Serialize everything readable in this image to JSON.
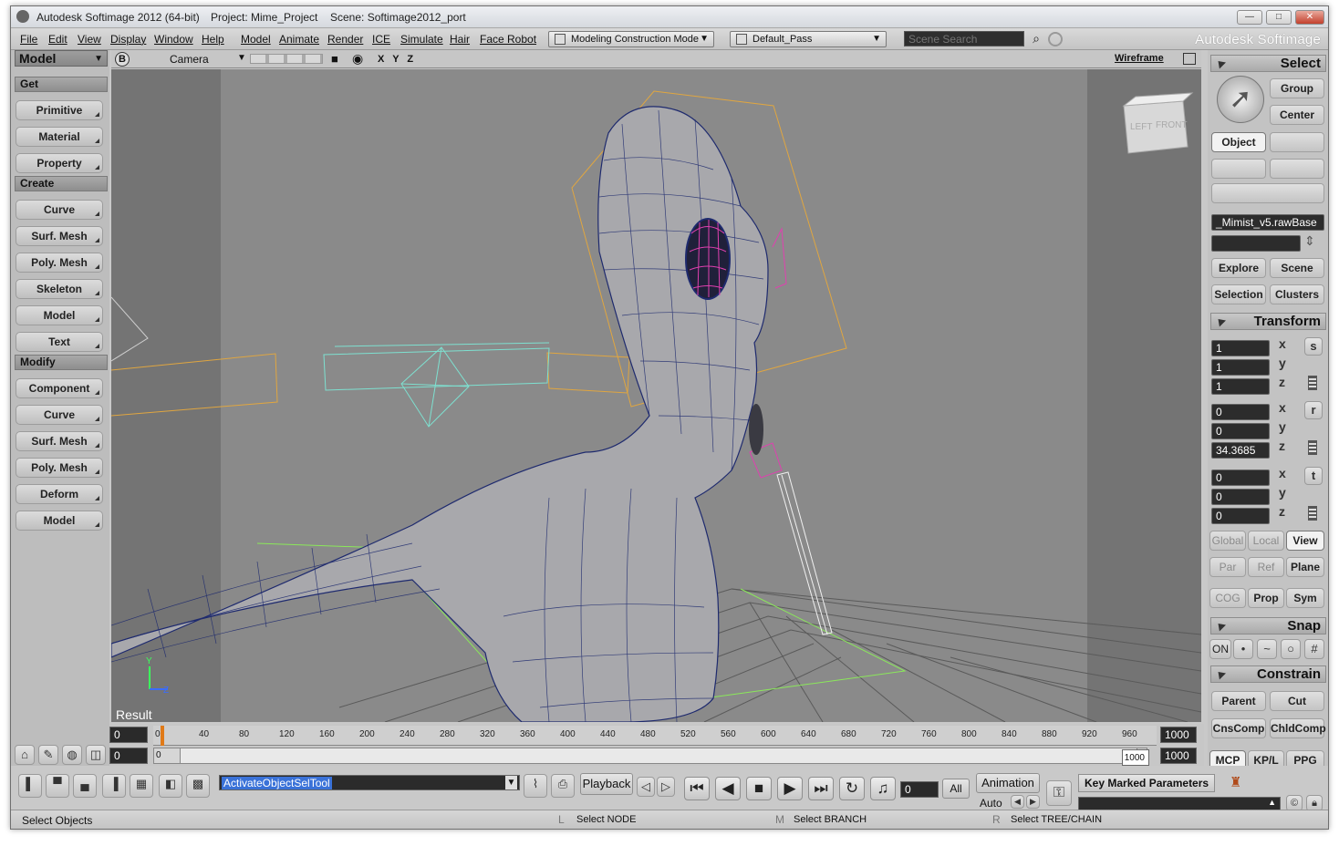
{
  "window": {
    "app_title": "Autodesk Softimage 2012 (64-bit)",
    "project": "Project: Mime_Project",
    "scene": "Scene: Softimage2012_port",
    "buttons": {
      "minimize": "—",
      "maximize": "□",
      "close": "✕"
    }
  },
  "menu": {
    "items": [
      "File",
      "Edit",
      "View",
      "Display",
      "Window",
      "Help",
      "Model",
      "Animate",
      "Render",
      "ICE",
      "Simulate",
      "Hair",
      "Face Robot"
    ],
    "construction_mode": "Modeling Construction Mode",
    "pass": "Default_Pass",
    "search_placeholder": "Scene Search",
    "brand": "Autodesk Softimage"
  },
  "left_panel": {
    "toolbar_title": "Model",
    "sections": [
      {
        "title": "Get",
        "buttons": [
          "Primitive",
          "Material",
          "Property"
        ]
      },
      {
        "title": "Create",
        "buttons": [
          "Curve",
          "Surf. Mesh",
          "Poly. Mesh",
          "Skeleton",
          "Model",
          "Text"
        ]
      },
      {
        "title": "Modify",
        "buttons": [
          "Component",
          "Curve",
          "Surf. Mesh",
          "Poly. Mesh",
          "Deform",
          "Model"
        ]
      }
    ]
  },
  "viewport": {
    "camera": "Camera",
    "badge": "B",
    "axes": "X Y Z",
    "display_mode": "Wireframe",
    "corner_label": "Result",
    "cube_left": "LEFT",
    "cube_front": "FRONT",
    "axis_y": "Y",
    "axis_z": "Z"
  },
  "timeline": {
    "start": "0",
    "end": "1000",
    "ticks": [
      "0",
      "40",
      "80",
      "120",
      "160",
      "200",
      "240",
      "280",
      "320",
      "360",
      "400",
      "440",
      "480",
      "520",
      "560",
      "600",
      "640",
      "680",
      "720",
      "760",
      "800",
      "840",
      "880",
      "920",
      "960"
    ],
    "range_start": "0",
    "range_left": "0",
    "range_end_a": "1000",
    "range_end_b": "1000"
  },
  "right_panel": {
    "select_title": "Select",
    "group": "Group",
    "center": "Center",
    "object": "Object",
    "object_name": "_Mimist_v5.rawBase",
    "explore": "Explore",
    "scene": "Scene",
    "selection": "Selection",
    "clusters": "Clusters",
    "transform_title": "Transform",
    "scale": {
      "x": "1",
      "y": "1",
      "z": "1",
      "label": "s"
    },
    "rotation": {
      "x": "0",
      "y": "0",
      "z": "34.3685",
      "label": "r"
    },
    "translation": {
      "x": "0",
      "y": "0",
      "z": "0",
      "label": "t"
    },
    "axis_labels": [
      "x",
      "y",
      "z"
    ],
    "ref_modes": [
      "Global",
      "Local",
      "View"
    ],
    "ref_modes2": [
      "Par",
      "Ref",
      "Plane"
    ],
    "cog": "COG",
    "prop": "Prop",
    "sym": "Sym",
    "snap_title": "Snap",
    "snap_on": "ON",
    "constrain_title": "Constrain",
    "parent": "Parent",
    "cut": "Cut",
    "cnscomp": "CnsComp",
    "chldcomp": "ChldComp",
    "tabs": [
      "MCP",
      "KP/L",
      "PPG"
    ]
  },
  "bottom": {
    "command": "ActivateObjectSelTool",
    "playback": "Playback",
    "frame": "0",
    "all": "All",
    "animation": "Animation",
    "auto": "Auto",
    "key_marked": "Key Marked Parameters"
  },
  "status": {
    "left": "Select Objects",
    "l_key": "L",
    "l_text": "Select NODE",
    "m_key": "M",
    "m_text": "Select BRANCH",
    "r_key": "R",
    "r_text": "Select TREE/CHAIN"
  },
  "colors": {
    "viewport_bg": "#747474",
    "mesh_line": "#1e2a6e",
    "highlight_pink": "#e040b0",
    "bbox_orange": "#e0a640",
    "bone_cyan": "#7ee0d0",
    "selection_blue": "#3a72d8"
  }
}
